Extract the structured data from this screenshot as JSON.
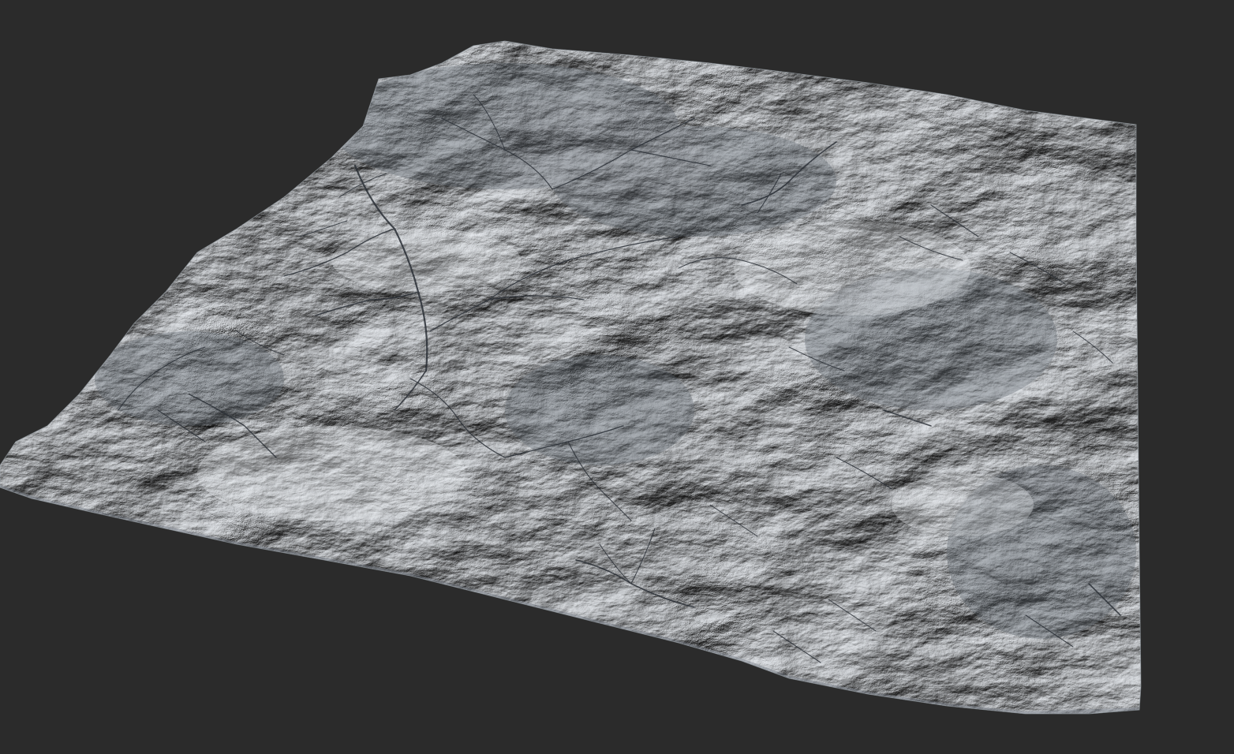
{
  "scene": {
    "background_color": "#2b2b2b",
    "terrain_base_color": "#b9bfc6",
    "terrain_light_color": "#dfe3e8",
    "terrain_shadow_color": "#4a5058",
    "channel_color": "#2a2f36"
  }
}
